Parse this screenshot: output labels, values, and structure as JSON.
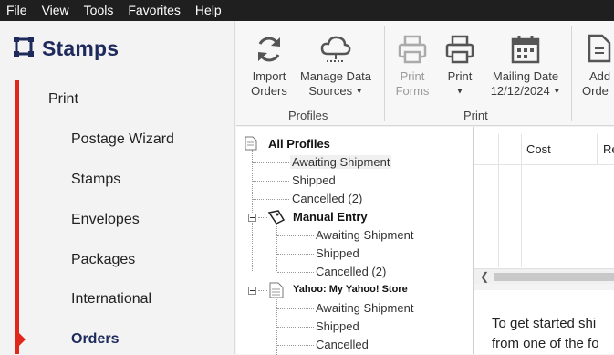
{
  "menu": [
    "File",
    "View",
    "Tools",
    "Favorites",
    "Help"
  ],
  "brand": {
    "name": "Stamps"
  },
  "nav": {
    "section": "Print",
    "items": [
      {
        "label": "Postage Wizard",
        "active": false
      },
      {
        "label": "Stamps",
        "active": false
      },
      {
        "label": "Envelopes",
        "active": false
      },
      {
        "label": "Packages",
        "active": false
      },
      {
        "label": "International",
        "active": false
      },
      {
        "label": "Orders",
        "active": true
      }
    ]
  },
  "ribbon": {
    "import": {
      "line1": "Import",
      "line2": "Orders",
      "icon": "refresh-icon"
    },
    "manage": {
      "line1": "Manage Data",
      "line2": "Sources",
      "icon": "cloud-network-icon"
    },
    "profiles_group": "Profiles",
    "print_forms": {
      "line1": "Print",
      "line2": "Forms",
      "icon": "printer-icon"
    },
    "print": {
      "line1": "Print",
      "icon": "printer-icon"
    },
    "mailing_date": {
      "line1": "Mailing Date",
      "line2": "12/12/2024",
      "icon": "calendar-icon"
    },
    "print_group": "Print",
    "add": {
      "line1": "Add",
      "line2": "Orde",
      "icon": "document-add-icon"
    }
  },
  "tree": {
    "all_profiles": "All Profiles",
    "root_items": [
      "Awaiting Shipment",
      "Shipped",
      "Cancelled (2)"
    ],
    "manual_entry": {
      "label": "Manual Entry",
      "items": [
        "Awaiting Shipment",
        "Shipped",
        "Cancelled (2)"
      ]
    },
    "yahoo": {
      "label": "Yahoo: My Yahoo! Store",
      "items": [
        "Awaiting Shipment",
        "Shipped",
        "Cancelled"
      ]
    }
  },
  "grid": {
    "columns": [
      "Cost",
      "Re"
    ]
  },
  "info": {
    "line1": "To get started shi",
    "line2": "from one of the fo"
  },
  "colors": {
    "accent_red": "#e1261c",
    "brand_navy": "#1d2a5b",
    "menubar": "#1f1f1f"
  }
}
